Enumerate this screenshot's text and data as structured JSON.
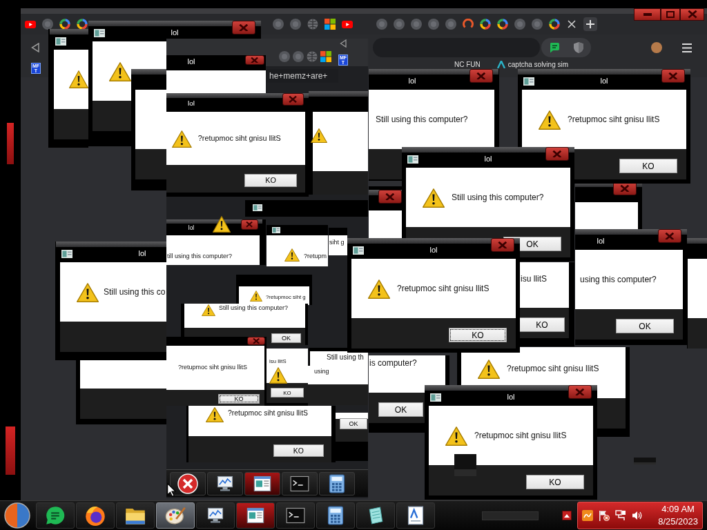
{
  "browser": {
    "badge": [
      "MF",
      "T"
    ],
    "bookmarks": [
      {
        "label": "NC FUN"
      },
      {
        "label": "captcha solving sim"
      }
    ]
  },
  "screen_copy": {
    "address_text": "he+memz+are+",
    "badge": [
      "MF",
      "T"
    ],
    "taskbar_apps": [
      {
        "alert": false
      },
      {
        "alert": false
      },
      {
        "alert": true
      },
      {
        "alert": false
      },
      {
        "alert": false
      }
    ]
  },
  "dialogs": [
    {
      "title": "lol"
    },
    {
      "title": "lol"
    },
    {
      "title": "lol",
      "message": "Still using this computer?"
    },
    {
      "title": "lol",
      "message": "?retupmoc siht gnisu llitS",
      "button": {
        "label": "KO",
        "focused": false
      }
    },
    {
      "title": "lol",
      "message": "?retupmoc siht gnisu llitS",
      "button": {
        "label": "KO",
        "focused": false
      }
    },
    {
      "title": "lol",
      "message": "Still using this computer?",
      "button": {
        "label": "OK",
        "focused": false
      }
    },
    {
      "title": "lol",
      "message": "Still using this co"
    },
    {
      "title": "lol",
      "message": "till using this computer?"
    },
    {
      "message": "?retupm"
    },
    {
      "message": "siht g"
    },
    {
      "message": "?retupmoc siht g"
    },
    {
      "message": "Still using this computer?",
      "button": {
        "label": "OK",
        "focused": false
      }
    },
    {
      "title": "lol",
      "message": "?retupmoc siht gnisu llitS",
      "button": {
        "label": "KO",
        "focused": true
      }
    },
    {
      "message": "isu llitS",
      "button": {
        "label": "KO",
        "focused": false
      }
    },
    {
      "title": "lol",
      "message": "using this computer?",
      "button": {
        "label": "OK",
        "focused": false
      }
    },
    {
      "message": "?retupmoc siht gnisu llitS",
      "button": {
        "label": "KO",
        "focused": true
      }
    },
    {
      "message": "isu llitS",
      "button": {
        "label": "KO",
        "focused": false
      }
    },
    {
      "message": "Still using th"
    },
    {
      "message": "using"
    },
    {
      "message": "is computer?",
      "button": {
        "label": "OK",
        "focused": false
      }
    },
    {
      "message": "?retupmoc siht gnisu llitS"
    },
    {
      "message": "?retupmoc siht gnisu llitS",
      "button": {
        "label": "KO",
        "focused": false
      }
    },
    {
      "button": {
        "label": "OK",
        "focused": false
      }
    },
    {
      "title": "lol",
      "message": "?retupmoc siht gnisu llitS",
      "button": {
        "label": "KO",
        "focused": false
      }
    }
  ],
  "taskbar": {
    "apps": [
      {
        "selected": false,
        "alert": false
      },
      {
        "selected": false,
        "alert": false
      },
      {
        "selected": false,
        "alert": false
      },
      {
        "selected": true,
        "alert": false
      },
      {
        "selected": false,
        "alert": false
      },
      {
        "selected": false,
        "alert": true
      },
      {
        "selected": false,
        "alert": false
      },
      {
        "selected": false,
        "alert": false
      },
      {
        "selected": false,
        "alert": false
      },
      {
        "selected": false,
        "alert": false
      }
    ],
    "clock": {
      "time": "4:09 AM",
      "date": "8/25/2023"
    }
  }
}
